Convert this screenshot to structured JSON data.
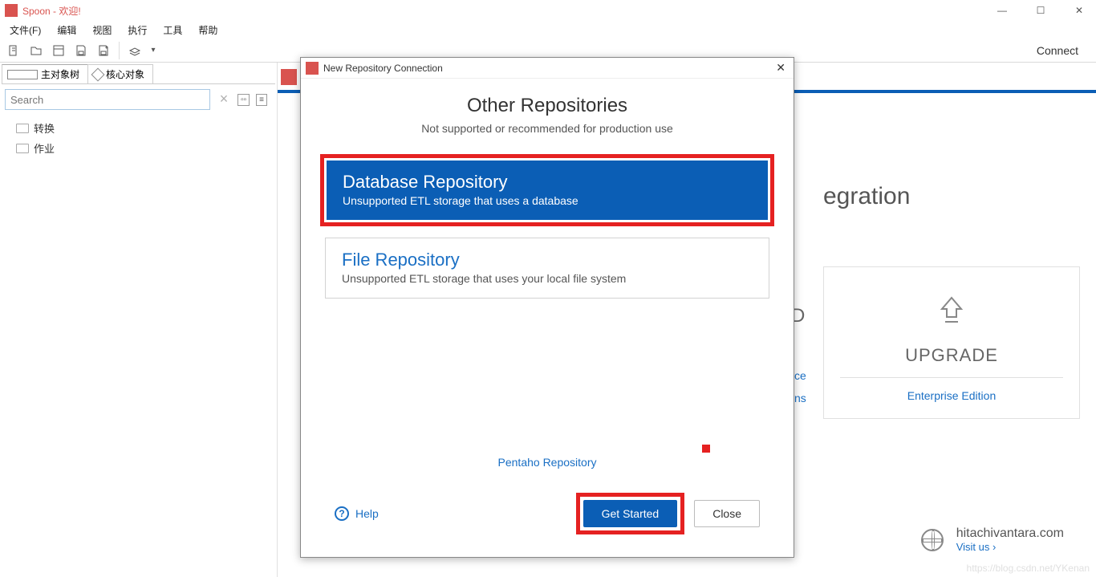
{
  "window": {
    "title": "Spoon - 欢迎!"
  },
  "menu": {
    "items": [
      "文件(F)",
      "编辑",
      "视图",
      "执行",
      "工具",
      "帮助"
    ]
  },
  "toolbar": {
    "connect": "Connect"
  },
  "sidebar": {
    "tabs": {
      "main": "主对象树",
      "core": "核心对象"
    },
    "search_placeholder": "Search",
    "tree": {
      "transform": "转换",
      "job": "作业"
    }
  },
  "welcome": {
    "heading_fragment": "egration",
    "upgrade_title": "UPGRADE",
    "upgrade_link": "Enterprise Edition",
    "side_link1": "ce",
    "side_link2": "ns",
    "side_letter": "D"
  },
  "brand": {
    "domain": "hitachivantara.com",
    "visit": "Visit us ›"
  },
  "watermark": "https://blog.csdn.net/YKenan",
  "dialog": {
    "title": "New Repository Connection",
    "heading": "Other Repositories",
    "subheading": "Not supported or recommended for production use",
    "options": {
      "db": {
        "title": "Database Repository",
        "desc": "Unsupported ETL storage that uses a database"
      },
      "file": {
        "title": "File Repository",
        "desc": "Unsupported ETL storage that uses your local file system"
      }
    },
    "pentaho_link": "Pentaho Repository",
    "help_label": "Help",
    "get_started": "Get Started",
    "close": "Close"
  }
}
